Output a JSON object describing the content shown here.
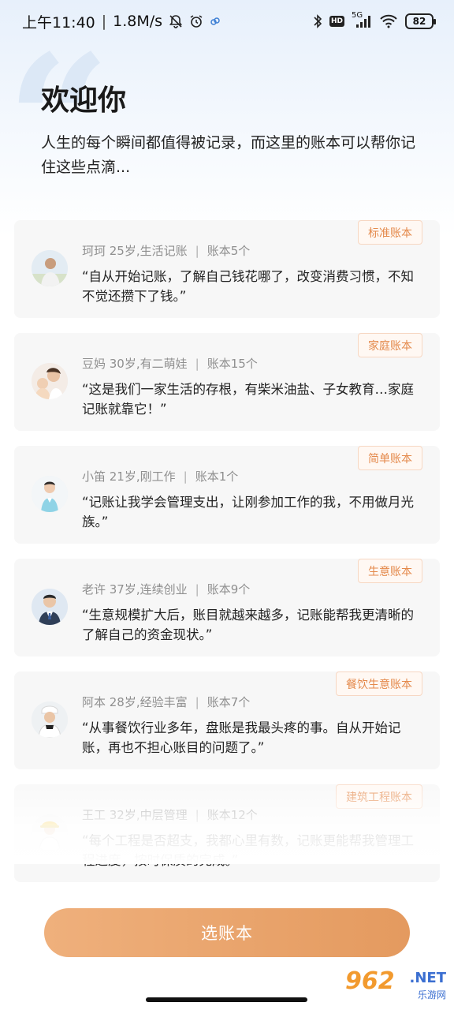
{
  "status_bar": {
    "time": "上午11:40",
    "speed": "1.8M/s",
    "network": "5G",
    "battery": "82"
  },
  "header": {
    "title": "欢迎你",
    "subtitle": "人生的每个瞬间都值得被记录，而这里的账本可以帮你记住这些点滴..."
  },
  "cards": [
    {
      "tag": "标准账本",
      "name_info": "珂珂 25岁,生活记账",
      "book_count": "账本5个",
      "quote": "“自从开始记账，了解自己钱花哪了，改变消费习惯，不知不觉还攒下了钱。”"
    },
    {
      "tag": "家庭账本",
      "name_info": "豆妈 30岁,有二萌娃",
      "book_count": "账本15个",
      "quote": "“这是我们一家生活的存根，有柴米油盐、子女教育…家庭记账就靠它！”"
    },
    {
      "tag": "简单账本",
      "name_info": "小笛 21岁,刚工作",
      "book_count": "账本1个",
      "quote": "“记账让我学会管理支出，让刚参加工作的我，不用做月光族。”"
    },
    {
      "tag": "生意账本",
      "name_info": "老许 37岁,连续创业",
      "book_count": "账本9个",
      "quote": "“生意规模扩大后，账目就越来越多，记账能帮我更清晰的了解自己的资金现状。”"
    },
    {
      "tag": "餐饮生意账本",
      "name_info": "阿本 28岁,经验丰富",
      "book_count": "账本7个",
      "quote": "“从事餐饮行业多年，盘账是我最头疼的事。自从开始记账，再也不担心账目的问题了。”"
    },
    {
      "tag": "建筑工程账本",
      "name_info": "王工 32岁,中层管理",
      "book_count": "账本12个",
      "quote": "“每个工程是否超支，我都心里有数，记账更能帮我管理工程进度，按时保质的完成。”"
    }
  ],
  "cta": {
    "label": "选账本"
  },
  "watermark": {
    "number": "962",
    "net": ".NET",
    "site": "乐游网"
  }
}
